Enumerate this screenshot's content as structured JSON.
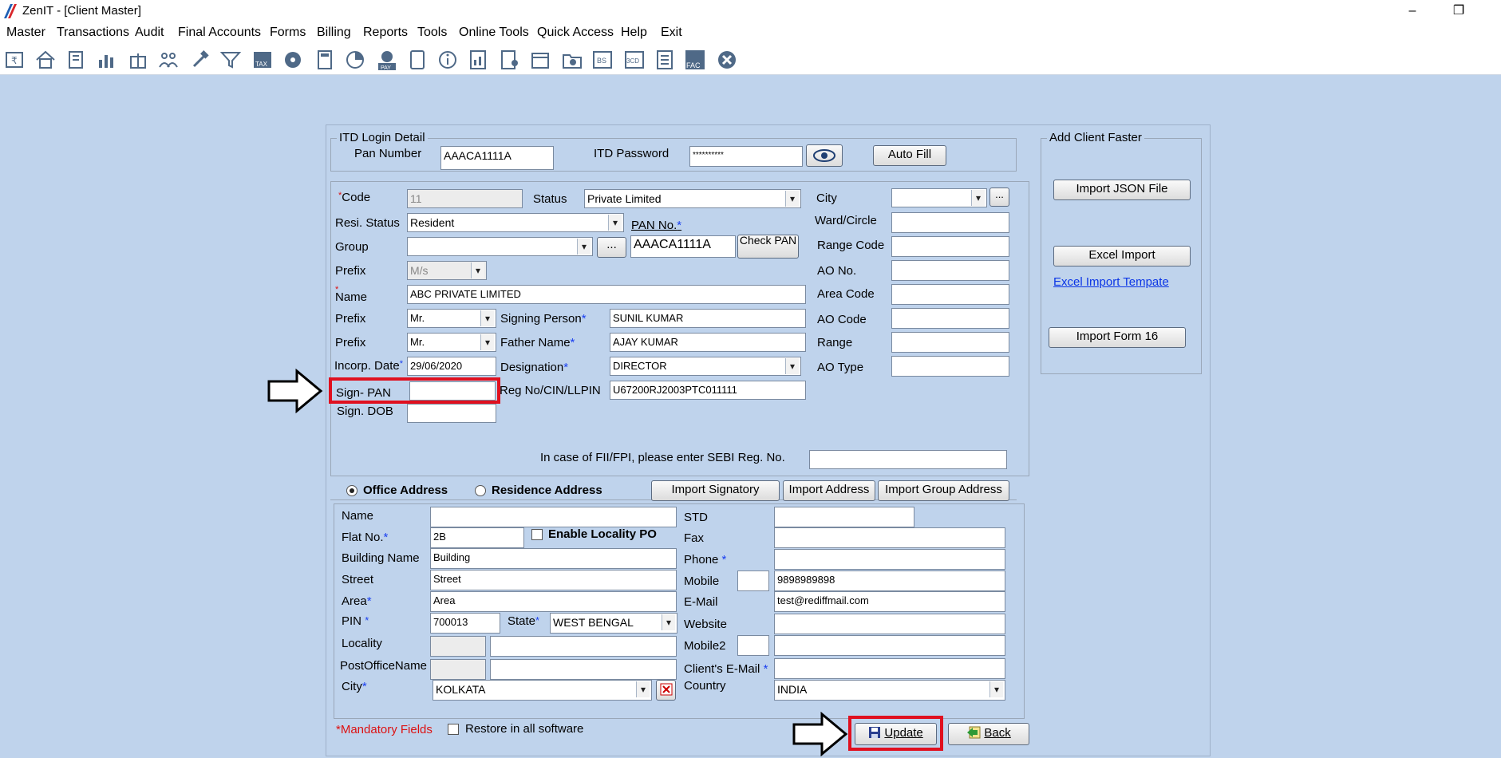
{
  "window": {
    "title": "ZenIT - [Client Master]",
    "minimize": "–",
    "restore": "❐"
  },
  "menu": [
    "Master",
    "Transactions",
    "Audit",
    "Final Accounts",
    "Forms",
    "Billing",
    "Reports",
    "Tools",
    "Online Tools",
    "Quick Access",
    "Help",
    "Exit"
  ],
  "toolbar": {
    "tax_label": "TAX",
    "pay_label": "PAY",
    "bs_label": "BS",
    "cd_label": "3CD",
    "fac_label": "FAC"
  },
  "itd": {
    "title": "ITD Login Detail",
    "pan_label": "Pan Number",
    "pan_value": "AAACA1111A",
    "password_label": "ITD Password",
    "password_value": "**********",
    "autofill": "Auto Fill"
  },
  "client": {
    "code_label": "Code",
    "code_value": "11",
    "status_label": "Status",
    "status_value": "Private Limited",
    "resi_label": "Resi. Status",
    "resi_value": "Resident",
    "pan_label": "PAN No.",
    "pan_value": "AAACA1111A",
    "check_pan": "Check PAN",
    "group_label": "Group",
    "group_value": "",
    "ellipsis": "...",
    "prefix_label": "Prefix",
    "prefix_value": "M/s",
    "name_label": "Name",
    "name_value": "ABC PRIVATE LIMITED",
    "prefix2_label": "Prefix",
    "prefix2_value": "Mr.",
    "signing_label": "Signing Person",
    "signing_value": "SUNIL KUMAR",
    "prefix3_label": "Prefix",
    "prefix3_value": "Mr.",
    "father_label": "Father Name",
    "father_value": "AJAY KUMAR",
    "incorp_label": "Incorp. Date",
    "incorp_value": "29/06/2020",
    "desig_label": "Designation",
    "desig_value": "DIRECTOR",
    "signpan_label": "Sign- PAN",
    "signpan_value": "",
    "reg_label": "Reg No/CIN/LLPIN",
    "reg_value": "U67200RJ2003PTC011111",
    "signdob_label": "Sign. DOB",
    "signdob_value": "",
    "sebi_label": "In case of FII/FPI, please enter SEBI Reg. No.",
    "sebi_value": "",
    "city_label": "City",
    "city_value": "",
    "ward_label": "Ward/Circle",
    "range_code_label": "Range Code",
    "ao_no_label": "AO No.",
    "area_code_label": "Area Code",
    "ao_code_label": "AO Code",
    "range_label": "Range",
    "ao_type_label": "AO Type"
  },
  "address": {
    "office": "Office Address",
    "residence": "Residence Address",
    "import_signatory": "Import Signatory",
    "import_address": "Import Address",
    "import_group": "Import Group Address",
    "name_label": "Name",
    "name_value": "",
    "flat_label": "Flat No.",
    "flat_value": "2B",
    "locality_po": "Enable Locality PO",
    "building_label": "Building Name",
    "building_value": "Building",
    "street_label": "Street",
    "street_value": "Street",
    "area_label": "Area",
    "area_value": "Area",
    "pin_label": "PIN",
    "pin_value": "700013",
    "state_label": "State",
    "state_value": "WEST BENGAL",
    "locality_label": "Locality",
    "po_label": "PostOfficeName",
    "city_label": "City",
    "city_value": "KOLKATA",
    "std_label": "STD",
    "fax_label": "Fax",
    "phone_label": "Phone",
    "mobile_label": "Mobile",
    "mobile_value": "9898989898",
    "email_label": "E-Mail",
    "email_value": "test@rediffmail.com",
    "website_label": "Website",
    "mobile2_label": "Mobile2",
    "client_email_label": "Client's E-Mail",
    "country_label": "Country",
    "country_value": "INDIA"
  },
  "faster": {
    "title": "Add Client Faster",
    "json": "Import JSON File",
    "excel": "Excel Import",
    "template": "Excel Import Tempate",
    "form16": "Import Form 16"
  },
  "footer": {
    "mandatory": "*Mandatory Fields",
    "restore": "Restore in all software",
    "update": "Update",
    "back": "Back"
  }
}
